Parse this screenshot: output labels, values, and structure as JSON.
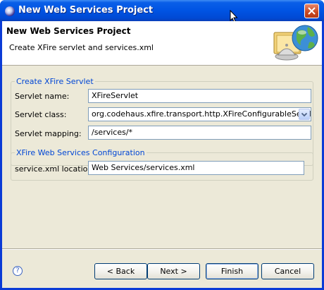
{
  "window": {
    "title": "New Web Services Project"
  },
  "banner": {
    "title": "New Web Services Project",
    "description": "Create XFire servlet and services.xml"
  },
  "servlet_group": {
    "legend": "Create XFire Servlet",
    "name_label": "Servlet name:",
    "name_value": "XFireServlet",
    "class_label": "Servlet class:",
    "class_value": "org.codehaus.xfire.transport.http.XFireConfigurableServlet",
    "mapping_label": "Servlet mapping:",
    "mapping_value": "/services/*"
  },
  "config_group": {
    "legend": "XFire Web Services Configuration",
    "location_label": "service.xml location:",
    "location_value": "Web Services/services.xml"
  },
  "buttons": {
    "help": "?",
    "back": "< Back",
    "next": "Next >",
    "finish": "Finish",
    "cancel": "Cancel"
  },
  "colors": {
    "titlebar": "#0054e3",
    "legend_text": "#0046d5",
    "dialog_bg": "#ece9d8"
  },
  "icons": {
    "title": "eclipse-icon",
    "close": "close-x-icon",
    "banner": "web-services-wizard-icon",
    "help": "help-icon"
  }
}
